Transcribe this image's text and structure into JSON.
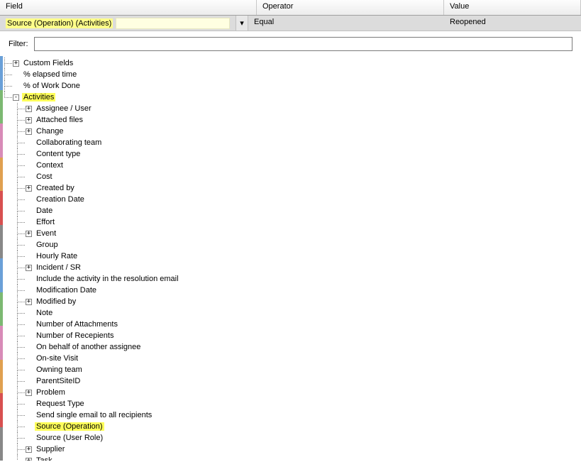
{
  "columns": {
    "field": "Field",
    "operator": "Operator",
    "value": "Value"
  },
  "row": {
    "field": "Source (Operation) (Activities)",
    "operator": "Equal",
    "value": "Reopened"
  },
  "filter": {
    "label": "Filter:",
    "value": ""
  },
  "tree": {
    "root": [
      {
        "label": "Custom Fields",
        "exp": "plus"
      },
      {
        "label": "% elapsed time"
      },
      {
        "label": "% of Work Done"
      },
      {
        "label": "Activities",
        "exp": "minus",
        "hl": true,
        "children": [
          {
            "label": "Assignee / User",
            "exp": "plus"
          },
          {
            "label": "Attached files",
            "exp": "plus"
          },
          {
            "label": "Change",
            "exp": "plus"
          },
          {
            "label": "Collaborating team"
          },
          {
            "label": "Content type"
          },
          {
            "label": "Context"
          },
          {
            "label": "Cost"
          },
          {
            "label": "Created by",
            "exp": "plus"
          },
          {
            "label": "Creation Date"
          },
          {
            "label": "Date"
          },
          {
            "label": "Effort"
          },
          {
            "label": "Event",
            "exp": "plus"
          },
          {
            "label": "Group"
          },
          {
            "label": "Hourly Rate"
          },
          {
            "label": "Incident / SR",
            "exp": "plus"
          },
          {
            "label": "Include the activity in the resolution email"
          },
          {
            "label": "Modification Date"
          },
          {
            "label": "Modified by",
            "exp": "plus"
          },
          {
            "label": "Note"
          },
          {
            "label": "Number of Attachments"
          },
          {
            "label": "Number of Recepients"
          },
          {
            "label": "On behalf of another assignee"
          },
          {
            "label": "On-site Visit"
          },
          {
            "label": "Owning team"
          },
          {
            "label": "ParentSiteID"
          },
          {
            "label": "Problem",
            "exp": "plus"
          },
          {
            "label": "Request Type"
          },
          {
            "label": "Send single email to all recipients"
          },
          {
            "label": "Source (Operation)",
            "hl": true
          },
          {
            "label": "Source (User Role)"
          },
          {
            "label": "Supplier",
            "exp": "plus"
          },
          {
            "label": "Task",
            "exp": "plus"
          }
        ]
      }
    ]
  }
}
